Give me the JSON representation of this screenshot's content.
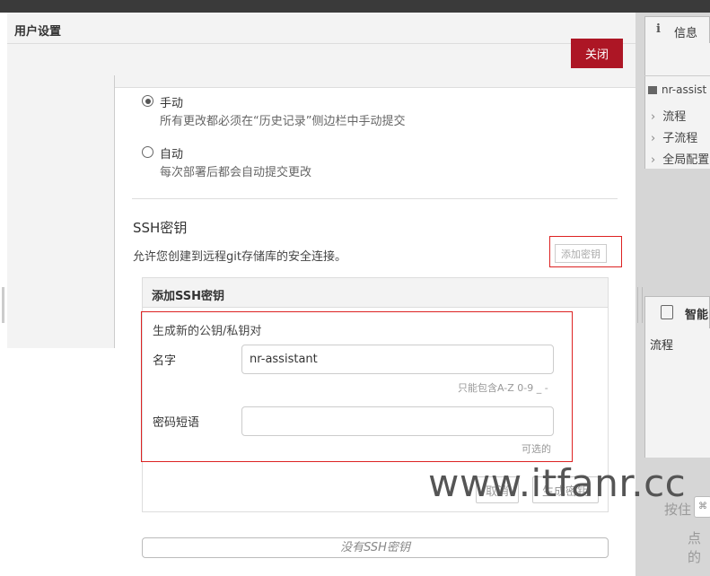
{
  "dialog": {
    "title": "用户设置",
    "close_label": "关闭"
  },
  "commit_mode": {
    "manual_label": "手动",
    "manual_desc": "所有更改都必须在“历史记录”侧边栏中手动提交",
    "auto_label": "自动",
    "auto_desc": "每次部署后都会自动提交更改",
    "selected": "manual"
  },
  "ssh": {
    "title": "SSH密钥",
    "description": "允许您创建到远程git存储库的安全连接。",
    "add_key_label": "添加密钥",
    "panel_title": "添加SSH密钥",
    "generate_title": "生成新的公钥/私钥对",
    "name_label": "名字",
    "name_value": "nr-assistant",
    "name_hint": "只能包含A-Z 0-9 _ -",
    "passphrase_label": "密码短语",
    "passphrase_value": "",
    "passphrase_hint": "可选的",
    "cancel_label": "取消",
    "generate_label": "生成密钥",
    "no_keys_label": "没有SSH密钥"
  },
  "right_panel": {
    "info_tab_label": "信息",
    "node_label": "nr-assist",
    "items": [
      "流程",
      "子流程",
      "全局配置"
    ],
    "assistant_tab_label": "智能",
    "flow_label": "流程",
    "press_text": "按住",
    "key_label": "⌘",
    "click_text": "点的"
  },
  "watermark": "www.itfanr.cc",
  "colors": {
    "accent": "#ad1625",
    "highlight_box": "#dd2222"
  }
}
